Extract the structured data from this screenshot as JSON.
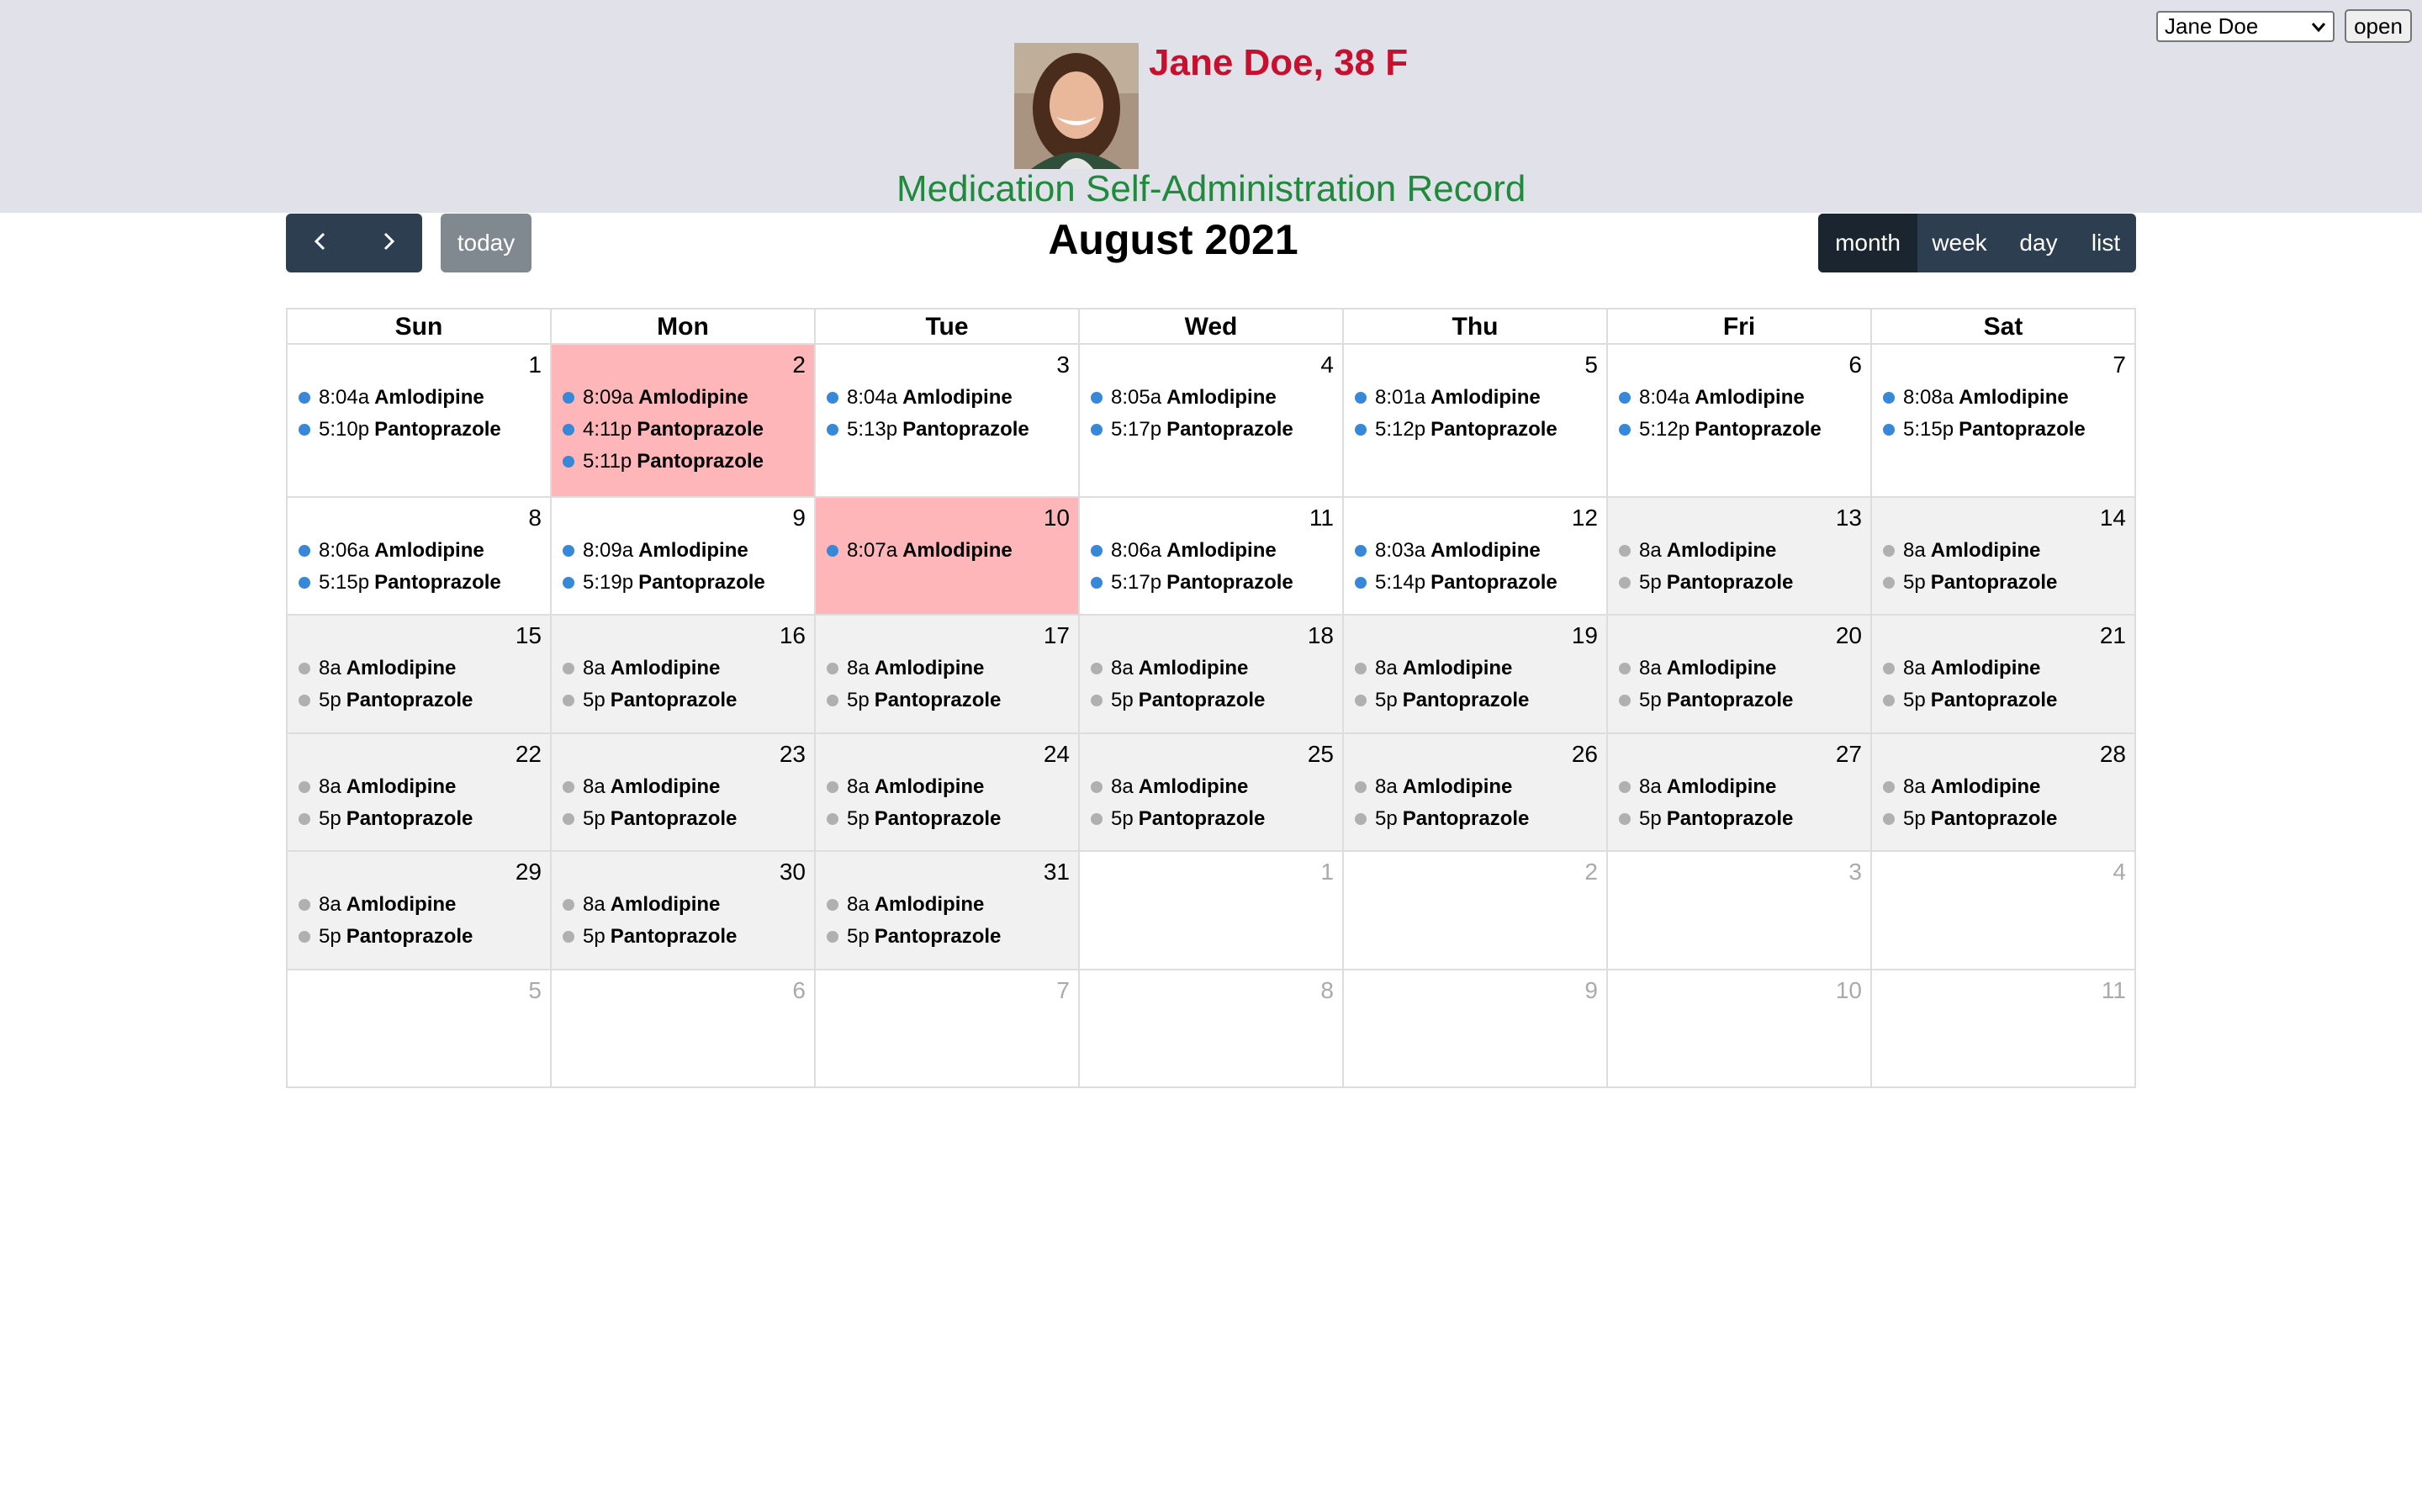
{
  "patient": {
    "name_line": "Jane Doe, 38 F",
    "record_title": "Medication Self-Administration Record",
    "selected_patient": "Jane Doe",
    "open_label": "open"
  },
  "toolbar": {
    "prev_icon": "chevron-left-icon",
    "next_icon": "chevron-right-icon",
    "today_label": "today",
    "title": "August 2021",
    "views": [
      "month",
      "week",
      "day",
      "list"
    ],
    "active_view": "month"
  },
  "colors": {
    "name": "#c8102e",
    "record_title": "#1f8a3b",
    "toolbar_button": "#2c3e50",
    "event_taken": "#3788d8",
    "event_scheduled": "#b0b0b0",
    "missed_day": "#ffb6b9",
    "future_day": "#f1f1f1"
  },
  "calendar": {
    "days_of_week": [
      "Sun",
      "Mon",
      "Tue",
      "Wed",
      "Thu",
      "Fri",
      "Sat"
    ],
    "weeks": [
      [
        {
          "num": "1",
          "state": "past",
          "events": [
            {
              "time": "8:04a",
              "med": "Amlodipine",
              "status": "taken"
            },
            {
              "time": "5:10p",
              "med": "Pantoprazole",
              "status": "taken"
            }
          ]
        },
        {
          "num": "2",
          "state": "missed",
          "events": [
            {
              "time": "8:09a",
              "med": "Amlodipine",
              "status": "taken"
            },
            {
              "time": "4:11p",
              "med": "Pantoprazole",
              "status": "taken"
            },
            {
              "time": "5:11p",
              "med": "Pantoprazole",
              "status": "taken"
            }
          ]
        },
        {
          "num": "3",
          "state": "past",
          "events": [
            {
              "time": "8:04a",
              "med": "Amlodipine",
              "status": "taken"
            },
            {
              "time": "5:13p",
              "med": "Pantoprazole",
              "status": "taken"
            }
          ]
        },
        {
          "num": "4",
          "state": "past",
          "events": [
            {
              "time": "8:05a",
              "med": "Amlodipine",
              "status": "taken"
            },
            {
              "time": "5:17p",
              "med": "Pantoprazole",
              "status": "taken"
            }
          ]
        },
        {
          "num": "5",
          "state": "past",
          "events": [
            {
              "time": "8:01a",
              "med": "Amlodipine",
              "status": "taken"
            },
            {
              "time": "5:12p",
              "med": "Pantoprazole",
              "status": "taken"
            }
          ]
        },
        {
          "num": "6",
          "state": "past",
          "events": [
            {
              "time": "8:04a",
              "med": "Amlodipine",
              "status": "taken"
            },
            {
              "time": "5:12p",
              "med": "Pantoprazole",
              "status": "taken"
            }
          ]
        },
        {
          "num": "7",
          "state": "past",
          "events": [
            {
              "time": "8:08a",
              "med": "Amlodipine",
              "status": "taken"
            },
            {
              "time": "5:15p",
              "med": "Pantoprazole",
              "status": "taken"
            }
          ]
        }
      ],
      [
        {
          "num": "8",
          "state": "past",
          "events": [
            {
              "time": "8:06a",
              "med": "Amlodipine",
              "status": "taken"
            },
            {
              "time": "5:15p",
              "med": "Pantoprazole",
              "status": "taken"
            }
          ]
        },
        {
          "num": "9",
          "state": "past",
          "events": [
            {
              "time": "8:09a",
              "med": "Amlodipine",
              "status": "taken"
            },
            {
              "time": "5:19p",
              "med": "Pantoprazole",
              "status": "taken"
            }
          ]
        },
        {
          "num": "10",
          "state": "missed",
          "events": [
            {
              "time": "8:07a",
              "med": "Amlodipine",
              "status": "taken"
            }
          ]
        },
        {
          "num": "11",
          "state": "past",
          "events": [
            {
              "time": "8:06a",
              "med": "Amlodipine",
              "status": "taken"
            },
            {
              "time": "5:17p",
              "med": "Pantoprazole",
              "status": "taken"
            }
          ]
        },
        {
          "num": "12",
          "state": "past",
          "events": [
            {
              "time": "8:03a",
              "med": "Amlodipine",
              "status": "taken"
            },
            {
              "time": "5:14p",
              "med": "Pantoprazole",
              "status": "taken"
            }
          ]
        },
        {
          "num": "13",
          "state": "future",
          "events": [
            {
              "time": "8a",
              "med": "Amlodipine",
              "status": "scheduled"
            },
            {
              "time": "5p",
              "med": "Pantoprazole",
              "status": "scheduled"
            }
          ]
        },
        {
          "num": "14",
          "state": "future",
          "events": [
            {
              "time": "8a",
              "med": "Amlodipine",
              "status": "scheduled"
            },
            {
              "time": "5p",
              "med": "Pantoprazole",
              "status": "scheduled"
            }
          ]
        }
      ],
      [
        {
          "num": "15",
          "state": "future",
          "events": [
            {
              "time": "8a",
              "med": "Amlodipine",
              "status": "scheduled"
            },
            {
              "time": "5p",
              "med": "Pantoprazole",
              "status": "scheduled"
            }
          ]
        },
        {
          "num": "16",
          "state": "future",
          "events": [
            {
              "time": "8a",
              "med": "Amlodipine",
              "status": "scheduled"
            },
            {
              "time": "5p",
              "med": "Pantoprazole",
              "status": "scheduled"
            }
          ]
        },
        {
          "num": "17",
          "state": "future",
          "events": [
            {
              "time": "8a",
              "med": "Amlodipine",
              "status": "scheduled"
            },
            {
              "time": "5p",
              "med": "Pantoprazole",
              "status": "scheduled"
            }
          ]
        },
        {
          "num": "18",
          "state": "future",
          "events": [
            {
              "time": "8a",
              "med": "Amlodipine",
              "status": "scheduled"
            },
            {
              "time": "5p",
              "med": "Pantoprazole",
              "status": "scheduled"
            }
          ]
        },
        {
          "num": "19",
          "state": "future",
          "events": [
            {
              "time": "8a",
              "med": "Amlodipine",
              "status": "scheduled"
            },
            {
              "time": "5p",
              "med": "Pantoprazole",
              "status": "scheduled"
            }
          ]
        },
        {
          "num": "20",
          "state": "future",
          "events": [
            {
              "time": "8a",
              "med": "Amlodipine",
              "status": "scheduled"
            },
            {
              "time": "5p",
              "med": "Pantoprazole",
              "status": "scheduled"
            }
          ]
        },
        {
          "num": "21",
          "state": "future",
          "events": [
            {
              "time": "8a",
              "med": "Amlodipine",
              "status": "scheduled"
            },
            {
              "time": "5p",
              "med": "Pantoprazole",
              "status": "scheduled"
            }
          ]
        }
      ],
      [
        {
          "num": "22",
          "state": "future",
          "events": [
            {
              "time": "8a",
              "med": "Amlodipine",
              "status": "scheduled"
            },
            {
              "time": "5p",
              "med": "Pantoprazole",
              "status": "scheduled"
            }
          ]
        },
        {
          "num": "23",
          "state": "future",
          "events": [
            {
              "time": "8a",
              "med": "Amlodipine",
              "status": "scheduled"
            },
            {
              "time": "5p",
              "med": "Pantoprazole",
              "status": "scheduled"
            }
          ]
        },
        {
          "num": "24",
          "state": "future",
          "events": [
            {
              "time": "8a",
              "med": "Amlodipine",
              "status": "scheduled"
            },
            {
              "time": "5p",
              "med": "Pantoprazole",
              "status": "scheduled"
            }
          ]
        },
        {
          "num": "25",
          "state": "future",
          "events": [
            {
              "time": "8a",
              "med": "Amlodipine",
              "status": "scheduled"
            },
            {
              "time": "5p",
              "med": "Pantoprazole",
              "status": "scheduled"
            }
          ]
        },
        {
          "num": "26",
          "state": "future",
          "events": [
            {
              "time": "8a",
              "med": "Amlodipine",
              "status": "scheduled"
            },
            {
              "time": "5p",
              "med": "Pantoprazole",
              "status": "scheduled"
            }
          ]
        },
        {
          "num": "27",
          "state": "future",
          "events": [
            {
              "time": "8a",
              "med": "Amlodipine",
              "status": "scheduled"
            },
            {
              "time": "5p",
              "med": "Pantoprazole",
              "status": "scheduled"
            }
          ]
        },
        {
          "num": "28",
          "state": "future",
          "events": [
            {
              "time": "8a",
              "med": "Amlodipine",
              "status": "scheduled"
            },
            {
              "time": "5p",
              "med": "Pantoprazole",
              "status": "scheduled"
            }
          ]
        }
      ],
      [
        {
          "num": "29",
          "state": "future",
          "events": [
            {
              "time": "8a",
              "med": "Amlodipine",
              "status": "scheduled"
            },
            {
              "time": "5p",
              "med": "Pantoprazole",
              "status": "scheduled"
            }
          ]
        },
        {
          "num": "30",
          "state": "future",
          "events": [
            {
              "time": "8a",
              "med": "Amlodipine",
              "status": "scheduled"
            },
            {
              "time": "5p",
              "med": "Pantoprazole",
              "status": "scheduled"
            }
          ]
        },
        {
          "num": "31",
          "state": "future",
          "events": [
            {
              "time": "8a",
              "med": "Amlodipine",
              "status": "scheduled"
            },
            {
              "time": "5p",
              "med": "Pantoprazole",
              "status": "scheduled"
            }
          ]
        },
        {
          "num": "1",
          "state": "other",
          "events": []
        },
        {
          "num": "2",
          "state": "other",
          "events": []
        },
        {
          "num": "3",
          "state": "other",
          "events": []
        },
        {
          "num": "4",
          "state": "other",
          "events": []
        }
      ],
      [
        {
          "num": "5",
          "state": "other",
          "events": []
        },
        {
          "num": "6",
          "state": "other",
          "events": []
        },
        {
          "num": "7",
          "state": "other",
          "events": []
        },
        {
          "num": "8",
          "state": "other",
          "events": []
        },
        {
          "num": "9",
          "state": "other",
          "events": []
        },
        {
          "num": "10",
          "state": "other",
          "events": []
        },
        {
          "num": "11",
          "state": "other",
          "events": []
        }
      ]
    ]
  }
}
